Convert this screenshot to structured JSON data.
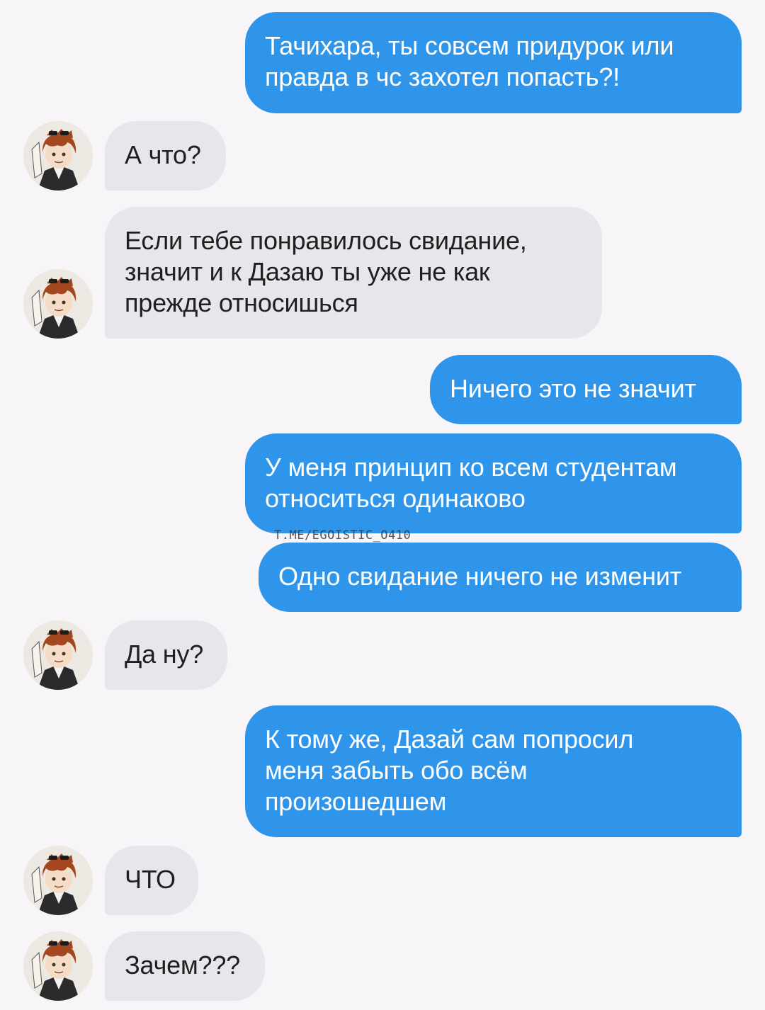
{
  "messages": [
    {
      "side": "out",
      "text": "Тачихара, ты совсем придурок или\nправда в чс захотел попасть?!"
    },
    {
      "side": "in",
      "text": "А что?"
    },
    {
      "side": "in",
      "text": "Если тебе понравилось свидание,\nзначит и к Дазаю ты уже не как\nпрежде относишься"
    },
    {
      "side": "out",
      "text": "Ничего это не значит"
    },
    {
      "side": "out",
      "text": "У меня принцип ко всем студентам\nотноситься одинаково"
    },
    {
      "side": "out",
      "text": "Одно свидание ничего не изменит"
    },
    {
      "side": "in",
      "text": "Да ну?"
    },
    {
      "side": "out",
      "text": "К тому же, Дазай сам попросил\nменя забыть обо всём\nпроизошедшем"
    },
    {
      "side": "in",
      "text": "ЧТО"
    },
    {
      "side": "in",
      "text": "Зачем???"
    }
  ],
  "watermark": "T.ME/EGOISTIC_O410",
  "colors": {
    "background": "#f7f5f8",
    "outgoing_bubble": "#2f95ea",
    "incoming_bubble": "#e6e6eb",
    "outgoing_text": "#ffffff",
    "incoming_text": "#1f1f1f"
  },
  "avatar": {
    "icon": "character-portrait-avatar"
  }
}
